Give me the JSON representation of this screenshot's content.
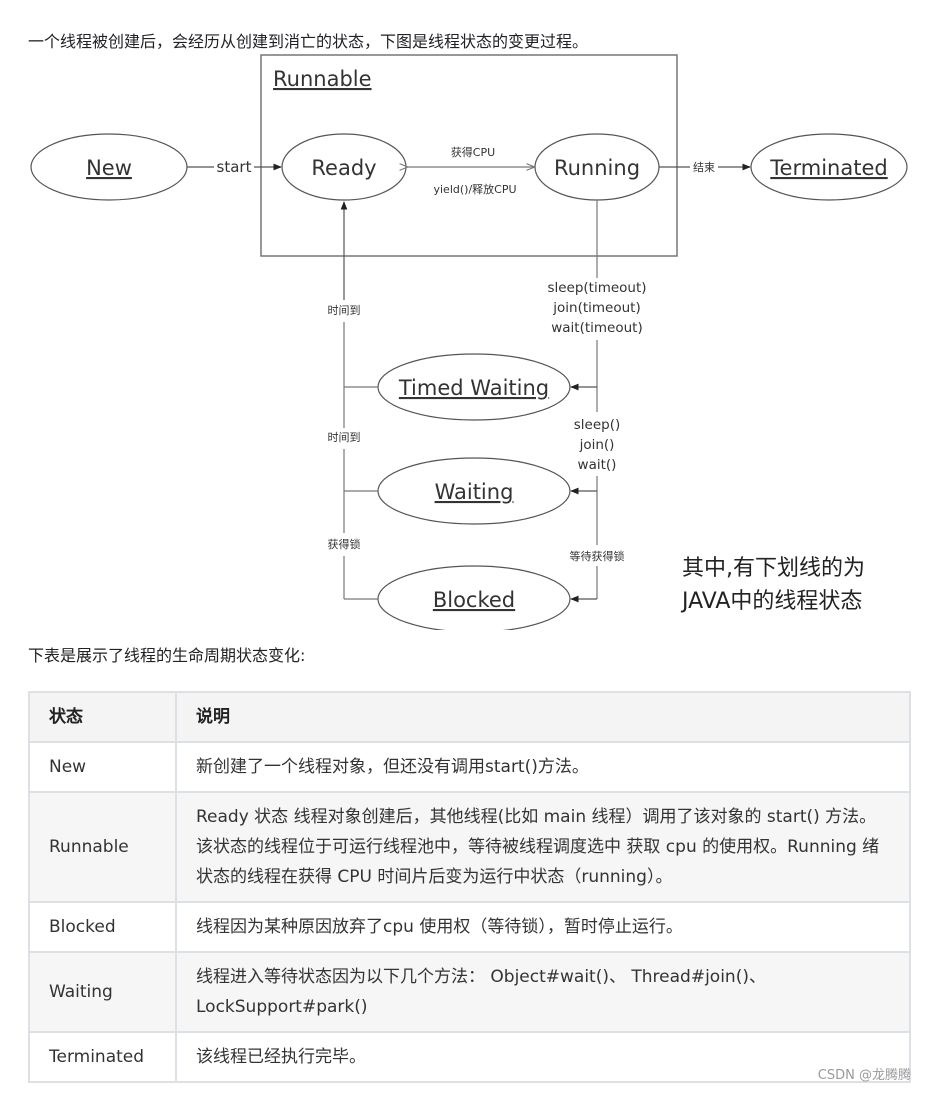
{
  "intro_text": "一个线程被创建后，会经历从创建到消亡的状态，下图是线程状态的变更过程。",
  "diagram": {
    "group_label": "Runnable",
    "states": {
      "new": "New",
      "ready": "Ready",
      "running": "Running",
      "terminated": "Terminated",
      "timed_waiting": "Timed Waiting",
      "waiting": "Waiting",
      "blocked": "Blocked"
    },
    "edges": {
      "start": "start",
      "get_cpu": "获得CPU",
      "yield": "yield()/释放CPU",
      "finish": "结束",
      "timeout_methods": [
        "sleep(timeout)",
        "join(timeout)",
        "wait(timeout)"
      ],
      "wait_methods": [
        "sleep()",
        "join()",
        "wait()"
      ],
      "wait_lock": "等待获得锁",
      "time_up_1": "时间到",
      "time_up_2": "时间到",
      "get_lock": "获得锁"
    },
    "note_lines": [
      "其中,有下划线的为",
      "JAVA中的线程状态"
    ]
  },
  "table_intro": "下表是展示了线程的生命周期状态变化:",
  "table": {
    "headers": [
      "状态",
      "说明"
    ],
    "rows": [
      {
        "state": "New",
        "desc": "新创建了一个线程对象，但还没有调用start()方法。"
      },
      {
        "state": "Runnable",
        "desc": "Ready 状态 线程对象创建后，其他线程(比如 main 线程）调用了该对象的 start() 方法。该状态的线程位于可运行线程池中，等待被线程调度选中 获取 cpu 的使用权。Running 绪状态的线程在获得 CPU 时间片后变为运行中状态（running）。"
      },
      {
        "state": "Blocked",
        "desc": "线程因为某种原因放弃了cpu 使用权（等待锁），暂时停止运行。"
      },
      {
        "state": "Waiting",
        "desc": "线程进入等待状态因为以下几个方法： Object#wait()、 Thread#join()、 LockSupport#park()"
      },
      {
        "state": "Terminated",
        "desc": "该线程已经执行完毕。"
      }
    ]
  },
  "watermark": "CSDN @龙腾腾"
}
